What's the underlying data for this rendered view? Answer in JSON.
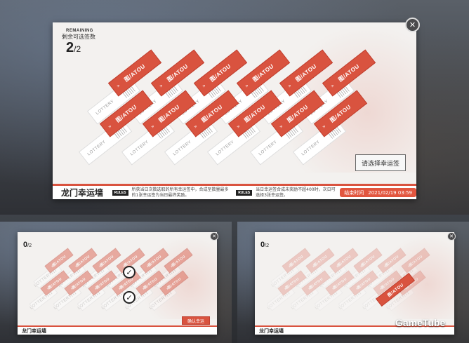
{
  "main": {
    "remaining_en": "REMAINING",
    "remaining_cn": "剩余可选签数",
    "remaining_value": "2",
    "remaining_total": "/2",
    "select_button": "请选择幸运签",
    "title": "龙门幸运墙",
    "rules_tag": "RULES",
    "rules_1": "所获当日次数选取的所有幸运签中，合成至数量最多的1张幸运签为当日最终奖励。",
    "rules_2": "当日幸运签合成未奖励不超400时，次日可选择3张幸运签。",
    "end_label": "结束时间",
    "end_time": "2021/02/19 03:59",
    "close_glyph": "✕"
  },
  "ticket_labels": {
    "red": "图/ATOU",
    "red_stub": "»",
    "white": "LOTTERY"
  },
  "secondary_left": {
    "remaining_value": "0",
    "remaining_total": "/2",
    "confirm_button": "确认幸运",
    "title": "龙门幸运墙",
    "check_glyph": "✓"
  },
  "secondary_right": {
    "remaining_value": "0",
    "remaining_total": "/2",
    "title": "龙门幸运墙"
  },
  "watermark": "GameTube",
  "colors": {
    "accent": "#d9533f",
    "card": "#f3f1ef"
  }
}
